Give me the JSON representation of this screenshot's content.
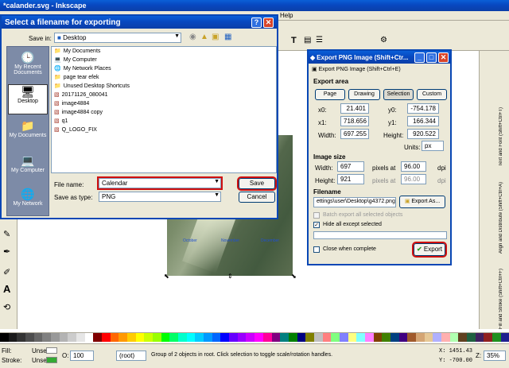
{
  "app": {
    "title": "*calander.svg - Inkscape",
    "menu": [
      "Help"
    ]
  },
  "palette": [
    "#000000",
    "#1a1a1a",
    "#333333",
    "#4d4d4d",
    "#666666",
    "#808080",
    "#999999",
    "#b3b3b3",
    "#cccccc",
    "#e6e6e6",
    "#ffffff",
    "#800000",
    "#ff0000",
    "#ff6600",
    "#ff9900",
    "#ffcc00",
    "#ffff00",
    "#ccff00",
    "#99ff00",
    "#00ff00",
    "#00ff66",
    "#00ffcc",
    "#00ffff",
    "#00ccff",
    "#0099ff",
    "#0066ff",
    "#0000ff",
    "#6600ff",
    "#9900ff",
    "#cc00ff",
    "#ff00ff",
    "#ff0099",
    "#800080",
    "#008080",
    "#008000",
    "#000080",
    "#808000",
    "#c0c0c0",
    "#ff8080",
    "#80ff80",
    "#8080ff",
    "#ffff80",
    "#80ffff",
    "#ff80ff",
    "#804000",
    "#408000",
    "#004080",
    "#400080",
    "#a05a2c",
    "#d4a574",
    "#e6c896",
    "#b0b0ff",
    "#ffb0b0",
    "#b0ffb0",
    "#604020",
    "#206040",
    "#402060",
    "#902020",
    "#209020",
    "#202090"
  ],
  "status": {
    "fill_label": "Fill:",
    "fill_value": "Unset",
    "stroke_label": "Stroke:",
    "stroke_value": "Unset",
    "opacity_label": "O:",
    "opacity_value": "100",
    "layer": "(root)",
    "message": "Group of 2 objects in root. Click selection to toggle scale/rotation handles.",
    "coords_x": "X: 1451.43",
    "coords_y": "Y: -700.00",
    "zoom_label": "Z:",
    "zoom": "35%"
  },
  "dock": {
    "tabs": [
      "Fill and Stroke (Shift+Ctrl+F)",
      "Align and Distribute (Shift+Ctrl+A)",
      "Text and Font (Shift+Ctrl+T)"
    ]
  },
  "calendar": {
    "months": [
      "October",
      "November",
      "December"
    ]
  },
  "save_dialog": {
    "title": "Select a filename for exporting",
    "save_in_label": "Save in:",
    "save_in_value": "Desktop",
    "places": [
      "My Recent Documents",
      "Desktop",
      "My Documents",
      "My Computer",
      "My Network"
    ],
    "files": [
      "My Documents",
      "My Computer",
      "My Network Places",
      "page tear efek",
      "Unused Desktop Shortcuts",
      "20171126_080041",
      "image4884",
      "image4884 copy",
      "q1",
      "Q_LOGO_FIX"
    ],
    "filename_label": "File name:",
    "filename_value": "Calendar",
    "type_label": "Save as type:",
    "type_value": "PNG",
    "save": "Save",
    "cancel": "Cancel"
  },
  "export": {
    "title": "Export PNG Image (Shift+Ctr...",
    "tab": "Export PNG Image (Shift+Ctrl+E)",
    "area_label": "Export area",
    "area_buttons": [
      "Page",
      "Drawing",
      "Selection",
      "Custom"
    ],
    "x0_label": "x0:",
    "x0": "21.401",
    "y0_label": "y0:",
    "y0": "-754.178",
    "x1_label": "x1:",
    "x1": "718.656",
    "y1_label": "y1:",
    "y1": "166.344",
    "width_label": "Width:",
    "width": "697.255",
    "height_label": "Height:",
    "height": "920.522",
    "units_label": "Units:",
    "units": "px",
    "size_label": "Image size",
    "img_width_label": "Width:",
    "img_width": "697",
    "pixels_at": "pixels at",
    "dpi_x": "96.00",
    "dpi": "dpi",
    "img_height_label": "Height:",
    "img_height": "921",
    "dpi_y": "96.00",
    "filename_label": "Filename",
    "filename": "ettings\\user\\Desktop\\g4372.png",
    "export_as": "Export As...",
    "batch": "Batch export all selected objects",
    "hide": "Hide all except selected",
    "close_when": "Close when complete",
    "export": "Export"
  }
}
